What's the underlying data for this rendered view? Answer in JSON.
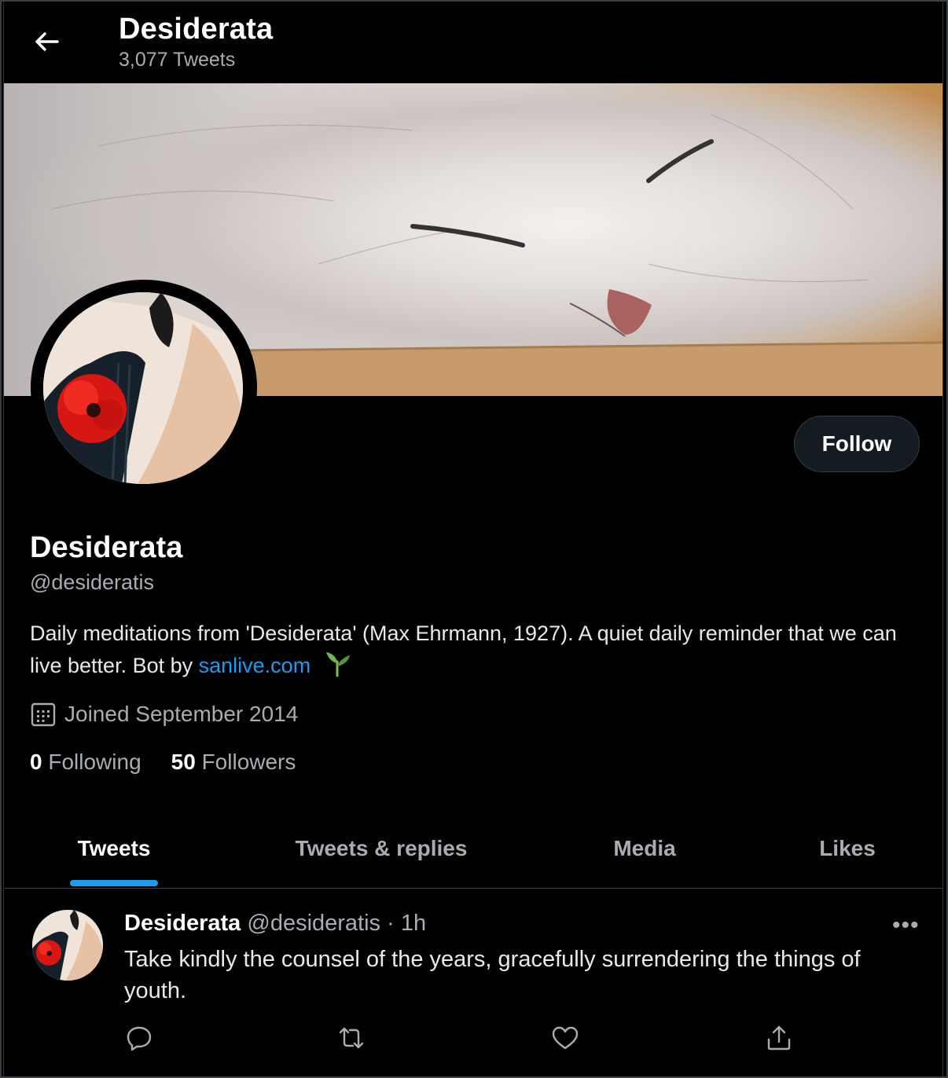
{
  "header": {
    "title": "Desiderata",
    "subtitle": "3,077 Tweets"
  },
  "profile": {
    "name": "Desiderata",
    "handle": "@desideratis",
    "bio_text": "Daily meditations from 'Desiderata' (Max Ehrmann, 1927). A quiet daily reminder that we can live better. Bot by ",
    "bio_link": "sanlive.com",
    "bio_emoji": "seedling-icon",
    "joined": "Joined September 2014",
    "follow_label": "Follow",
    "following_count": "0",
    "following_label": "Following",
    "followers_count": "50",
    "followers_label": "Followers"
  },
  "tabs": [
    {
      "label": "Tweets",
      "active": true
    },
    {
      "label": "Tweets & replies",
      "active": false
    },
    {
      "label": "Media",
      "active": false
    },
    {
      "label": "Likes",
      "active": false
    }
  ],
  "tweet": {
    "name": "Desiderata",
    "handle": "@desideratis",
    "separator": "·",
    "time": "1h",
    "text": "Take kindly the counsel of the years, gracefully surrendering the things of youth.",
    "more": "•••",
    "actions": [
      "reply-icon",
      "retweet-icon",
      "like-icon",
      "share-icon"
    ]
  },
  "colors": {
    "background": "#000000",
    "accent": "#1d9bf0",
    "text_primary": "#e7e9ea",
    "text_secondary": "#a9adb1",
    "follow_button_bg": "#141c22"
  }
}
